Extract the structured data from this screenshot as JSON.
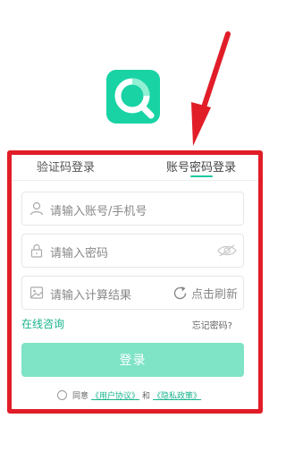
{
  "tabs": {
    "sms_login": "验证码登录",
    "password_login": "账号密码登录",
    "active": "password_login"
  },
  "form": {
    "account_placeholder": "请输入账号/手机号",
    "password_placeholder": "请输入密码",
    "captcha_placeholder": "请输入计算结果",
    "refresh_label": "点击刷新"
  },
  "links": {
    "online_consult": "在线咨询",
    "forgot_password": "忘记密码?"
  },
  "login_button": "登录",
  "agreement": {
    "prefix": "同意",
    "user_agreement": "《用户协议》",
    "and": "和",
    "privacy_policy": "《隐私政策》"
  },
  "icons": [
    "app-logo",
    "user-icon",
    "lock-icon",
    "eye-icon",
    "image-icon",
    "refresh-icon",
    "radio-icon",
    "annotation-arrow"
  ],
  "colors": {
    "accent": "#19c9a0",
    "button": "#7fe3c6",
    "annotation": "#e11d28"
  }
}
